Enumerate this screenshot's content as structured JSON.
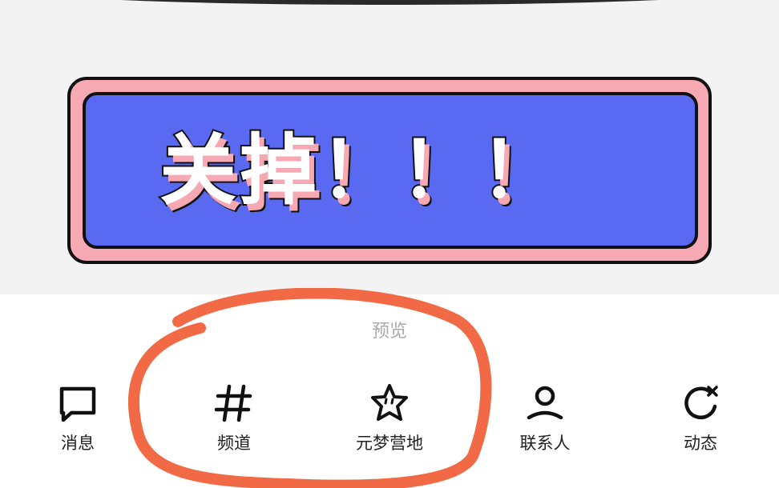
{
  "banner": {
    "text": "关掉！！！",
    "colors": {
      "fill": "#5969f2",
      "frame": "#f7a9b3",
      "outline": "#111111"
    }
  },
  "preview": {
    "label": "预览"
  },
  "tabs": [
    {
      "label": "消息",
      "icon": "chat-bubble-icon"
    },
    {
      "label": "频道",
      "icon": "hash-icon"
    },
    {
      "label": "元梦营地",
      "icon": "star-face-icon"
    },
    {
      "label": "联系人",
      "icon": "person-icon"
    },
    {
      "label": "动态",
      "icon": "refresh-star-icon"
    }
  ],
  "annotation": {
    "color": "#f26a45",
    "icon": "hand-drawn-circle"
  }
}
